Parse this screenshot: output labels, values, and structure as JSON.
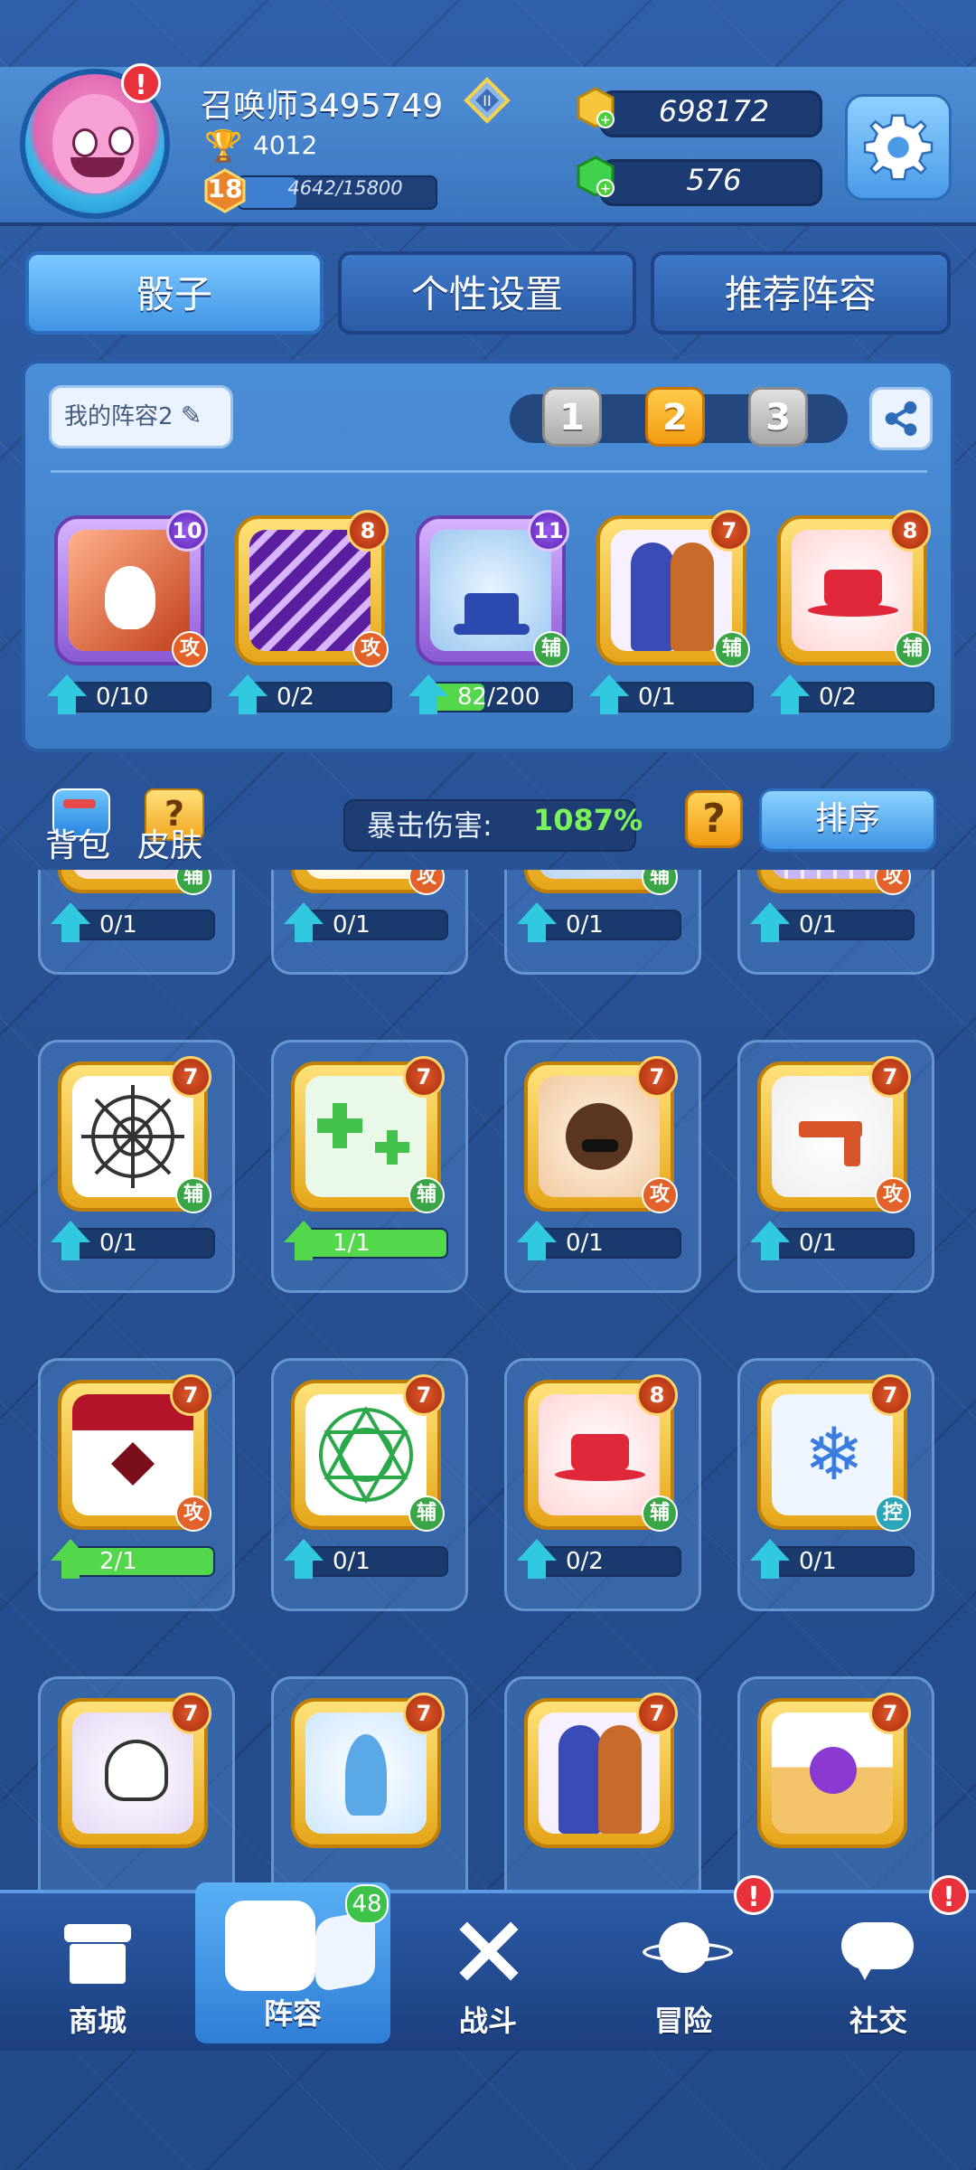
{
  "player": {
    "name": "召唤师3495749",
    "trophies": "4012",
    "level": "18",
    "xp_text": "4642/15800",
    "xp_progress": 0.2938
  },
  "currency": {
    "gold": "698172",
    "gems": "576"
  },
  "tabs": [
    {
      "label": "骰子",
      "active": true
    },
    {
      "label": "个性设置",
      "active": false
    },
    {
      "label": "推荐阵容",
      "active": false
    }
  ],
  "deck": {
    "name": "我的阵容2",
    "pages": [
      "1",
      "2",
      "3"
    ],
    "active_page": 1,
    "cards": [
      {
        "icon": "claw-slash-icon",
        "level": "10",
        "rarity": "purple",
        "type": "攻",
        "progress": "0/10",
        "fill": 0
      },
      {
        "icon": "purple-slash-icon",
        "level": "8",
        "rarity": "gold",
        "type": "攻",
        "progress": "0/2",
        "fill": 0
      },
      {
        "icon": "magic-hat-icon",
        "level": "11",
        "rarity": "purple",
        "type": "辅",
        "progress": "82/200",
        "fill": 0.41
      },
      {
        "icon": "twin-silhouette-icon",
        "level": "7",
        "rarity": "gold",
        "type": "辅",
        "progress": "0/1",
        "fill": 0
      },
      {
        "icon": "red-hat-icon",
        "level": "8",
        "rarity": "gold",
        "type": "辅",
        "progress": "0/2",
        "fill": 0
      }
    ]
  },
  "toolbar": {
    "bag_label": "背包",
    "skin_label": "皮肤",
    "crit_label": "暴击伤害:",
    "crit_value": "1087%",
    "help_label": "?",
    "sort_label": "排序"
  },
  "collection": [
    {
      "icon": "paw-icon",
      "level": "",
      "type": "辅",
      "progress": "0/1",
      "fill": 0
    },
    {
      "icon": "antler-icon",
      "level": "",
      "type": "攻",
      "progress": "0/1",
      "fill": 0
    },
    {
      "icon": "moon-icon",
      "level": "",
      "type": "辅",
      "progress": "0/1",
      "fill": 0
    },
    {
      "icon": "pixel-wall-icon",
      "level": "",
      "type": "攻",
      "progress": "0/1",
      "fill": 0
    },
    {
      "icon": "spider-web-icon",
      "level": "7",
      "type": "辅",
      "progress": "0/1",
      "fill": 0
    },
    {
      "icon": "green-cross-icon",
      "level": "7",
      "type": "辅",
      "progress": "1/1",
      "fill": 1
    },
    {
      "icon": "masked-head-icon",
      "level": "7",
      "type": "攻",
      "progress": "0/1",
      "fill": 0
    },
    {
      "icon": "revolver-icon",
      "level": "7",
      "type": "攻",
      "progress": "0/1",
      "fill": 0
    },
    {
      "icon": "shuriken-blood-icon",
      "level": "7",
      "type": "攻",
      "progress": "2/1",
      "fill": 1
    },
    {
      "icon": "magic-circle-icon",
      "level": "7",
      "type": "辅",
      "progress": "0/1",
      "fill": 0
    },
    {
      "icon": "red-hat-icon",
      "level": "8",
      "type": "辅",
      "progress": "0/2",
      "fill": 0
    },
    {
      "icon": "snowflake-icon",
      "level": "7",
      "type": "控",
      "progress": "0/1",
      "fill": 0
    },
    {
      "icon": "skull-icon",
      "level": "7",
      "type": "",
      "progress": "",
      "fill": 0
    },
    {
      "icon": "ice-spirit-icon",
      "level": "7",
      "type": "",
      "progress": "",
      "fill": 0
    },
    {
      "icon": "twin-silhouette-icon",
      "level": "7",
      "type": "",
      "progress": "",
      "fill": 0
    },
    {
      "icon": "bomb-icon",
      "level": "7",
      "type": "",
      "progress": "",
      "fill": 0
    }
  ],
  "bottom_nav": [
    {
      "label": "商城",
      "icon": "shop-icon",
      "badge": "",
      "alert": false,
      "active": false
    },
    {
      "label": "阵容",
      "icon": "dice-icon",
      "badge": "48",
      "alert": false,
      "active": true
    },
    {
      "label": "战斗",
      "icon": "crossed-swords-icon",
      "badge": "",
      "alert": false,
      "active": false
    },
    {
      "label": "冒险",
      "icon": "planet-icon",
      "badge": "",
      "alert": true,
      "active": false
    },
    {
      "label": "社交",
      "icon": "chat-icon",
      "badge": "",
      "alert": true,
      "active": false
    }
  ],
  "alerts": {
    "avatar": "!",
    "nav": "!"
  },
  "colors": {
    "background": "#2f5fa8",
    "accent_blue": "#3f94e4",
    "gold": "#f39a12",
    "progress_green": "#52d84a",
    "upgrade_cyan": "#30c9e0",
    "crit_green": "#7cf25a"
  }
}
